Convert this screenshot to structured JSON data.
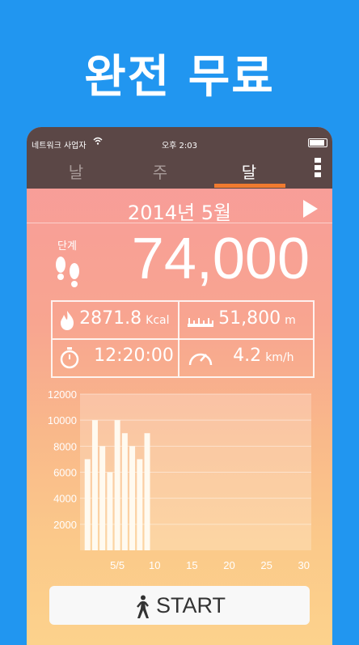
{
  "promo": {
    "headline": "완전 무료"
  },
  "status_bar": {
    "carrier": "네트워크 사업자",
    "time": "오후 2:03"
  },
  "tabs": [
    {
      "label": "날",
      "active": false
    },
    {
      "label": "주",
      "active": false
    },
    {
      "label": "달",
      "active": true
    }
  ],
  "period": {
    "title": "2014년 5월"
  },
  "steps": {
    "label": "단계",
    "value": "74,000"
  },
  "stats": {
    "calories": {
      "value": "2871.8",
      "unit": "Kcal",
      "icon": "flame-icon"
    },
    "distance": {
      "value": "51,800",
      "unit": "m",
      "icon": "ruler-icon"
    },
    "duration": {
      "value": "12:20:00",
      "icon": "stopwatch-icon"
    },
    "speed": {
      "value": "4.2",
      "unit": "km/h",
      "icon": "speedometer-icon"
    }
  },
  "start_button": {
    "label": "START",
    "icon": "walking-person-icon"
  },
  "colors": {
    "tab_bar": "#5b4746",
    "tab_accent": "#f07a2f",
    "background": "#2196f0"
  },
  "chart_data": {
    "type": "bar",
    "x": [
      1,
      2,
      3,
      4,
      5,
      6,
      7,
      8,
      9
    ],
    "values": [
      7000,
      10000,
      8000,
      6000,
      10000,
      9000,
      8000,
      7000,
      9000
    ],
    "xticks": [
      "5/5",
      "10",
      "15",
      "20",
      "25",
      "30"
    ],
    "xtick_values": [
      5,
      10,
      15,
      20,
      25,
      30
    ],
    "yticks": [
      "2000",
      "4000",
      "6000",
      "8000",
      "10000",
      "12000"
    ],
    "ytick_values": [
      2000,
      4000,
      6000,
      8000,
      10000,
      12000
    ],
    "xlim": [
      0,
      31
    ],
    "ylim": [
      0,
      12000
    ],
    "grid": true
  }
}
